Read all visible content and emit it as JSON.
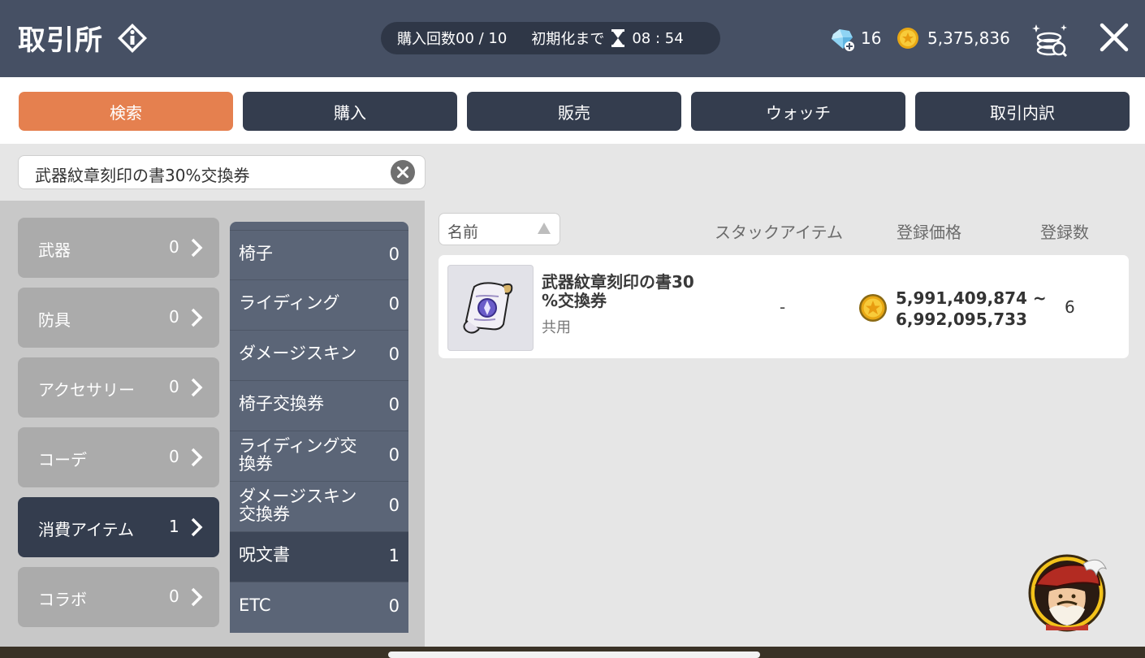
{
  "header": {
    "title": "取引所",
    "purchase_label": "購入回数",
    "purchase_count": "00 / 10",
    "reset_label": "初期化まで",
    "reset_time": "08 : 54",
    "gems": "16",
    "meso": "5,375,836"
  },
  "tabs": [
    {
      "label": "検索",
      "active": true
    },
    {
      "label": "購入",
      "active": false
    },
    {
      "label": "販売",
      "active": false
    },
    {
      "label": "ウォッチ",
      "active": false
    },
    {
      "label": "取引内訳",
      "active": false
    }
  ],
  "search": {
    "value": "武器紋章刻印の書30%交換券"
  },
  "categories": [
    {
      "name": "武器",
      "count": "0"
    },
    {
      "name": "防具",
      "count": "0"
    },
    {
      "name": "アクセサリー",
      "count": "0"
    },
    {
      "name": "コーデ",
      "count": "0"
    },
    {
      "name": "消費アイテム",
      "count": "1",
      "active": true
    },
    {
      "name": "コラボ",
      "count": "0"
    }
  ],
  "subcategories": [
    {
      "name": "椅子",
      "count": "0"
    },
    {
      "name": "ライディング",
      "count": "0"
    },
    {
      "name": "ダメージスキン",
      "count": "0"
    },
    {
      "name": "椅子交換券",
      "count": "0"
    },
    {
      "name_line1": "ライディング交",
      "name_line2": "換券",
      "count": "0"
    },
    {
      "name_line1": "ダメージスキン",
      "name_line2": "交換券",
      "count": "0"
    },
    {
      "name": "呪文書",
      "count": "1",
      "active": true
    },
    {
      "name": "ETC",
      "count": "0"
    }
  ],
  "results_header": {
    "sort_label": "名前",
    "stack_label": "スタックアイテム",
    "price_label": "登録価格",
    "count_label": "登録数"
  },
  "results": [
    {
      "name_line1": "武器紋章刻印の書30",
      "name_line2": "%交換券",
      "type": "共用",
      "stack": "-",
      "price_min": "5,991,409,874 ~",
      "price_max": "6,992,095,733",
      "count": "6"
    }
  ],
  "colors": {
    "header_bg": "#465064",
    "tab_active": "#e5804f",
    "tab_inactive": "#343d4e",
    "category_inactive": "#ababab",
    "subcategory_bg": "#5b6577"
  }
}
